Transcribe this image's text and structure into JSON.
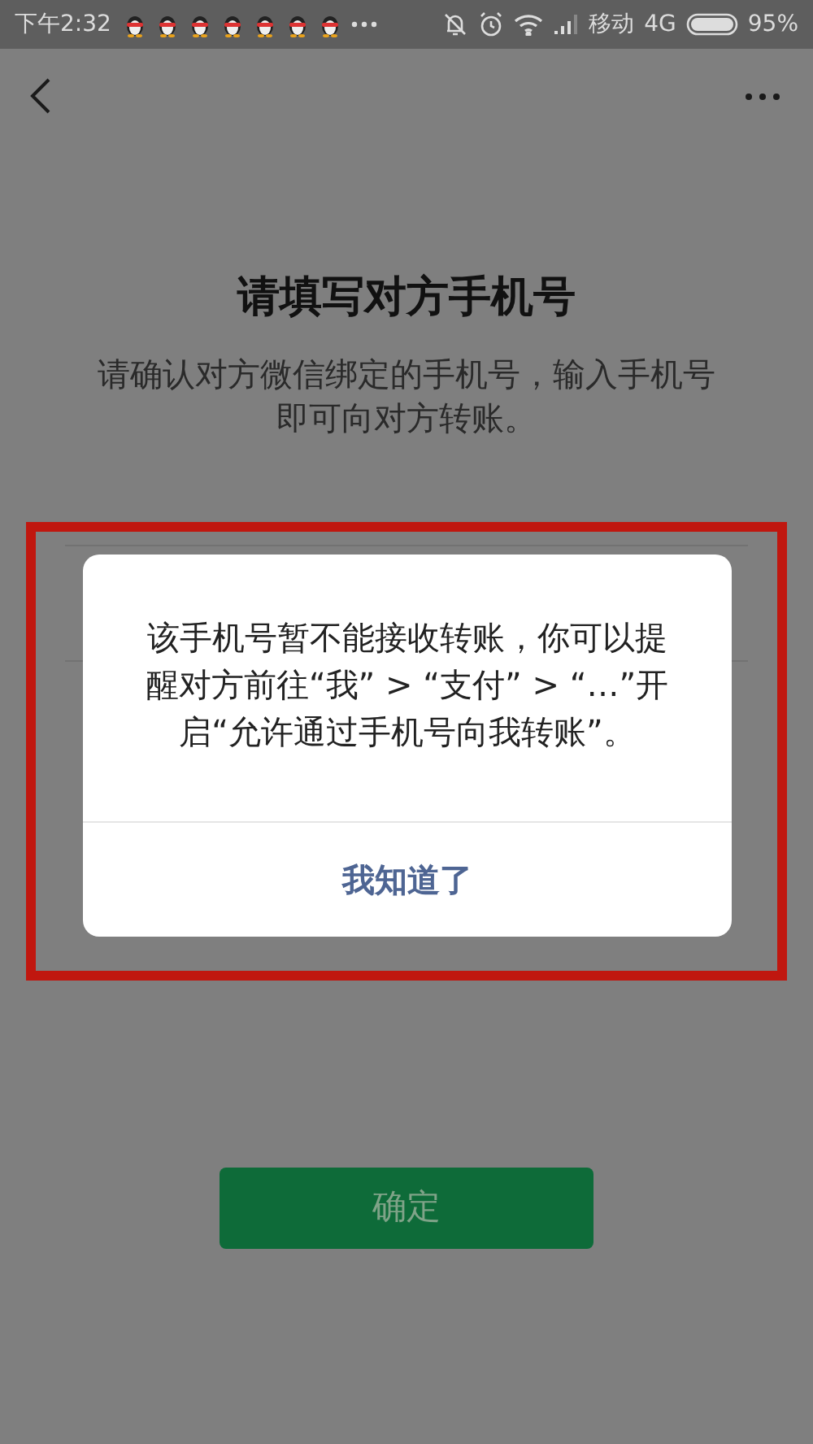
{
  "status_bar": {
    "time": "下午2:32",
    "carrier": "移动",
    "network": "4G",
    "battery": "95%"
  },
  "title": "请填写对方手机号",
  "subtitle": "请确认对方微信绑定的手机号，输入手机号即可向对方转账。",
  "confirm_button": {
    "label": "确定",
    "disabled": true
  },
  "dialog": {
    "message": "该手机号暂不能接收转账，你可以提醒对方前往“我” > “支付” > “…”开启“允许通过手机号向我转账”。",
    "button": "我知道了"
  }
}
